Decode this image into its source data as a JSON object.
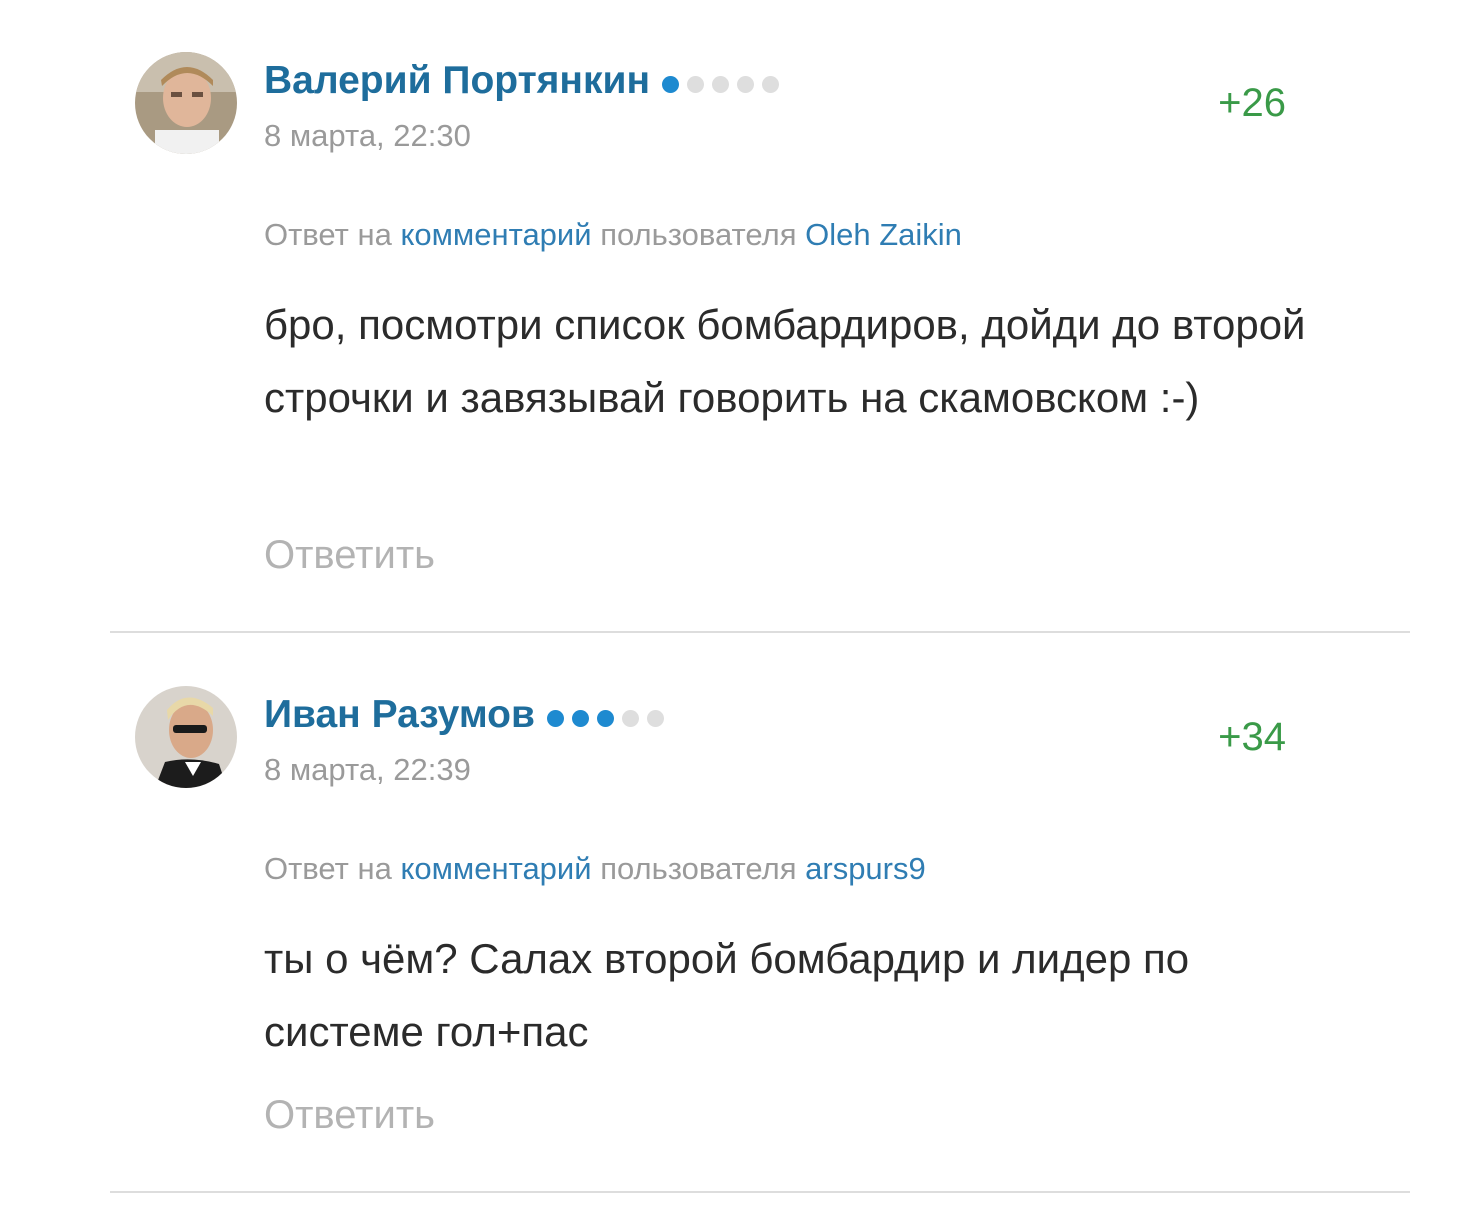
{
  "comments": [
    {
      "author": "Валерий Портянкин",
      "rank_dots_filled": 1,
      "rank_dots_total": 5,
      "date": "8 марта, 22:30",
      "rating": "+26",
      "reply_prefix": "Ответ на",
      "reply_link": "комментарий",
      "reply_middle": "пользователя",
      "reply_user": "Oleh Zaikin",
      "text": "бро, посмотри список бомбардиров, дойди до второй строчки и завязывай говорить на скамовском :-)",
      "reply_label": "Ответить"
    },
    {
      "author": "Иван Разумов",
      "rank_dots_filled": 3,
      "rank_dots_total": 5,
      "date": "8 марта, 22:39",
      "rating": "+34",
      "reply_prefix": "Ответ на",
      "reply_link": "комментарий",
      "reply_middle": "пользователя",
      "reply_user": "arspurs9",
      "text": "ты о чём? Салах второй бомбардир и лидер по системе гол+пас",
      "reply_label": "Ответить"
    }
  ],
  "colors": {
    "author": "#1e6d9c",
    "link": "#2f7db3",
    "rating_positive": "#3a9a48",
    "rank_dot_on": "#1e8ad0",
    "rank_dot_off": "#dedede",
    "muted": "#9a9a9a"
  }
}
